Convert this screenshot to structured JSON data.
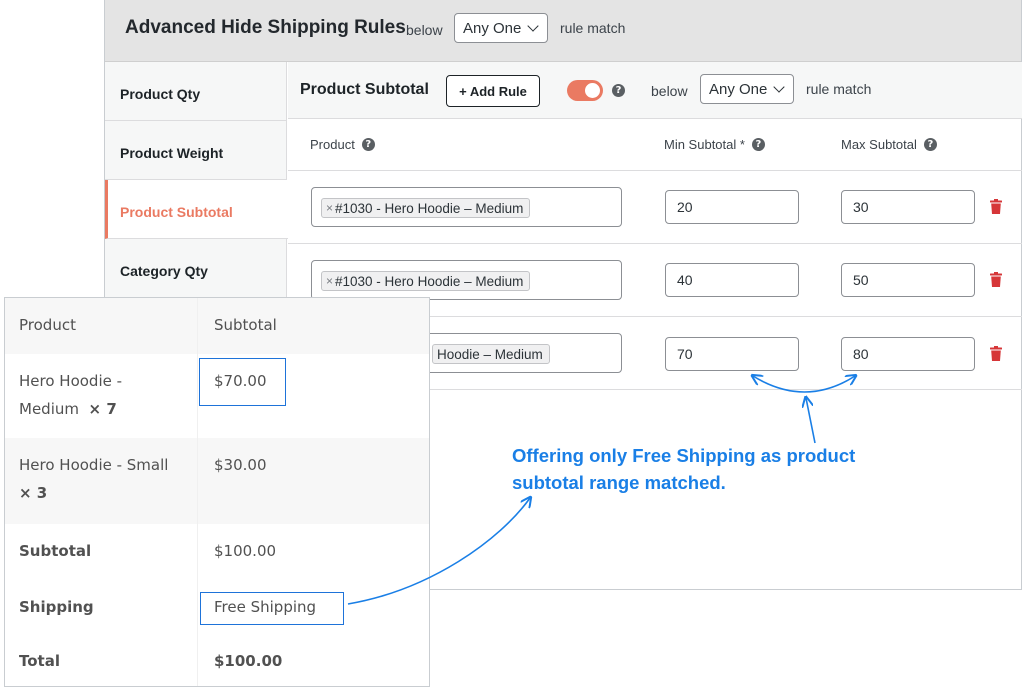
{
  "header": {
    "title": "Advanced Hide Shipping Rules",
    "below_label": "below",
    "match_select": "Any One",
    "rule_match_label": "rule match"
  },
  "sidebar": {
    "items": [
      {
        "label": "Product Qty",
        "active": false
      },
      {
        "label": "Product Weight",
        "active": false
      },
      {
        "label": "Product Subtotal",
        "active": true
      },
      {
        "label": "Category Qty",
        "active": false
      }
    ]
  },
  "section": {
    "title": "Product Subtotal",
    "add_rule_label": "+ Add Rule",
    "toggle_on": true,
    "help_glyph": "?",
    "below_label": "below",
    "match_select": "Any One",
    "rule_match_label": "rule match"
  },
  "columns": {
    "product": "Product",
    "min": "Min Subtotal *",
    "max": "Max Subtotal"
  },
  "rules": [
    {
      "product": "#1030 - Hero Hoodie – Medium",
      "remove": "×",
      "min": "20",
      "max": "30"
    },
    {
      "product": "#1030 - Hero Hoodie – Medium",
      "remove": "×",
      "min": "40",
      "max": "50"
    },
    {
      "product": "Hoodie – Medium",
      "min": "70",
      "max": "80"
    }
  ],
  "cart": {
    "head": {
      "product": "Product",
      "subtotal": "Subtotal"
    },
    "items": [
      {
        "name_line1": "Hero Hoodie -",
        "name_line2": "Medium",
        "qty": "× 7",
        "subtotal": "$70.00"
      },
      {
        "name_line1": "Hero Hoodie - Small",
        "name_line2": "",
        "qty": "× 3",
        "subtotal": "$30.00"
      }
    ],
    "subtotal": {
      "label": "Subtotal",
      "value": "$100.00"
    },
    "shipping": {
      "label": "Shipping",
      "value": "Free Shipping"
    },
    "total": {
      "label": "Total",
      "value": "$100.00"
    }
  },
  "annotation": {
    "line1": "Offering only Free Shipping as product",
    "line2": "subtotal range matched."
  },
  "colors": {
    "accent": "#ea7a62",
    "annotation_blue": "#1a7fe6",
    "trash_red": "#d63638"
  }
}
